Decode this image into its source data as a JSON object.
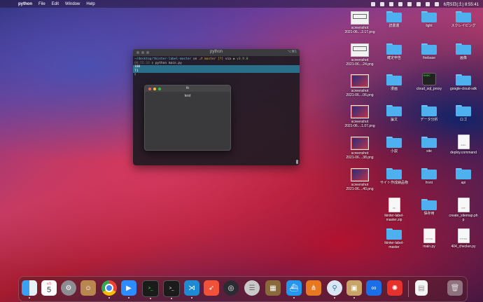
{
  "menubar": {
    "app": "python",
    "items": [
      "File",
      "Edit",
      "Window",
      "Help"
    ],
    "datetime": "6月5日(土) 8:55:41"
  },
  "terminal": {
    "title": "python",
    "shortcut": "⌥⌘1",
    "path": "~/desktop/tkinter-label-master",
    "on": "on",
    "branch": "master [?]",
    "via": "via",
    "version": "v3.9.0",
    "time": "08:55:33",
    "command": "python  main.py",
    "output1": "160",
    "output2": "71"
  },
  "tk_window": {
    "title": "tk",
    "label": "test"
  },
  "desktop_icons": [
    {
      "label": "screenshot\n2021-06....2.17.png",
      "kind": "thumb"
    },
    {
      "label": "screenshot\n2021-06....24.png",
      "kind": "thumb"
    },
    {
      "label": "screenshot\n2021-06....06.png",
      "kind": "thumb-dark"
    },
    {
      "label": "screenshot\n2021-06....1.07.png",
      "kind": "thumb-dark"
    },
    {
      "label": "screenshot\n2021-06....38.png",
      "kind": "thumb-dark"
    },
    {
      "label": "screenshot\n2021-06....40.png",
      "kind": "thumb-dark"
    },
    {
      "label": "tkinter-label-\nmaster.zip",
      "kind": "doc",
      "ft": "ZIP"
    },
    {
      "label": "tkinter-label-\nmaster",
      "kind": "folder"
    },
    {
      "label": "読書書",
      "kind": "folder"
    },
    {
      "label": "確定申告",
      "kind": "folder"
    },
    {
      "label": "漫画",
      "kind": "folder"
    },
    {
      "label": "論文",
      "kind": "folder"
    },
    {
      "label": "小説",
      "kind": "folder"
    },
    {
      "label": "サイト作成納品物",
      "kind": "folder"
    },
    {
      "label": "light",
      "kind": "folder"
    },
    {
      "label": "firebase",
      "kind": "folder"
    },
    {
      "label": "cloud_sql_proxy",
      "kind": "term"
    },
    {
      "label": "データ分析",
      "kind": "folder"
    },
    {
      "label": "site",
      "kind": "folder"
    },
    {
      "label": "front",
      "kind": "folder"
    },
    {
      "label": "保存用",
      "kind": "folder"
    },
    {
      "label": "main.py",
      "kind": "doc",
      "ft": "PYTHON"
    },
    {
      "label": "スクレイピング",
      "kind": "folder"
    },
    {
      "label": "画像",
      "kind": "folder"
    },
    {
      "label": "google-cloud-sdk",
      "kind": "folder"
    },
    {
      "label": "ロゴ",
      "kind": "folder"
    },
    {
      "label": "deploy.command",
      "kind": "doc",
      "ft": "EXEC"
    },
    {
      "label": "api",
      "kind": "folder"
    },
    {
      "label": "create_sitemap.ph\np",
      "kind": "doc",
      "ft": "PHP"
    },
    {
      "label": "404_checker.py",
      "kind": "doc",
      "ft": "PYTHON"
    }
  ],
  "dock": {
    "calendar_month": "6月",
    "calendar_day": "5",
    "apps": [
      "finder-icon",
      "calendar-icon",
      "system-preferences-icon",
      "contacts-icon",
      "chrome-icon",
      "zoom-icon",
      "terminal-icon",
      "terminal-icon",
      "vscode-icon",
      "swift-icon",
      "quicktime-icon",
      "sequel-icon",
      "archive-icon",
      "docker-icon",
      "sourcetree-icon",
      "python-icon",
      "preview-icon",
      "infinity-icon",
      "clock-icon",
      "document-icon",
      "trash-icon"
    ]
  }
}
